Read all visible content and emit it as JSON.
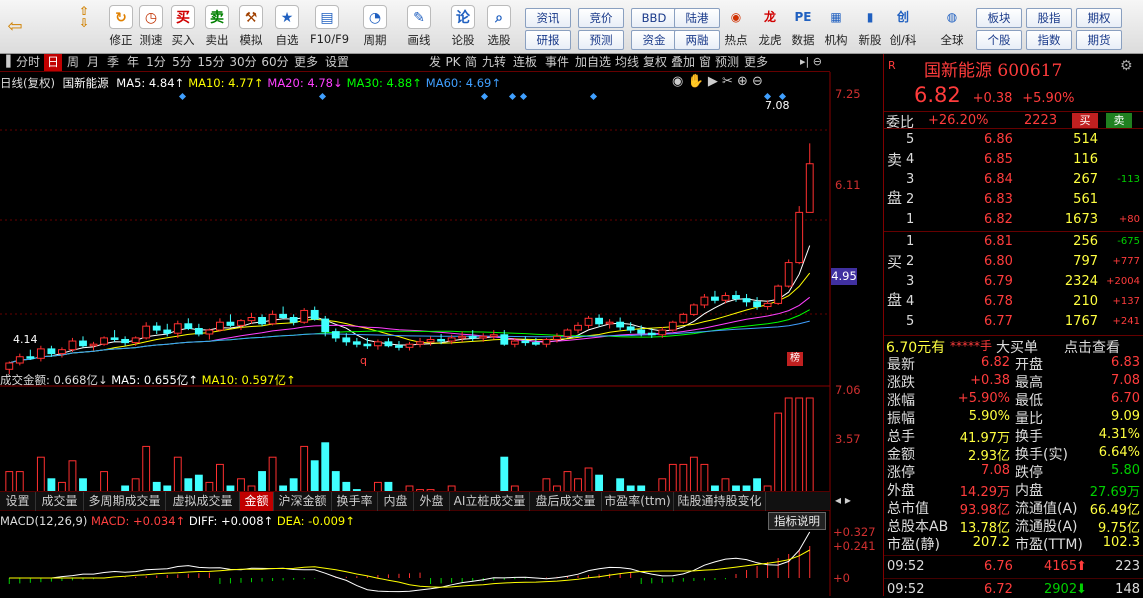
{
  "toolbar": {
    "buttons": [
      {
        "label": "修正",
        "icon": "refresh-icon",
        "glyph": "↻",
        "color": "#e08000"
      },
      {
        "label": "测速",
        "icon": "stopwatch-icon",
        "glyph": "◷",
        "color": "#c03000"
      },
      {
        "label": "买入",
        "icon": "buy-icon",
        "glyph": "买",
        "color": "#d00000"
      },
      {
        "label": "卖出",
        "icon": "sell-icon",
        "glyph": "卖",
        "color": "#008000"
      },
      {
        "label": "模拟",
        "icon": "hammer-icon",
        "glyph": "⚒",
        "color": "#a04000"
      },
      {
        "label": "自选",
        "icon": "star-icon",
        "glyph": "★",
        "color": "#2060c0"
      },
      {
        "label": "F10/F9",
        "icon": "window-icon",
        "glyph": "▤",
        "color": "#2060c0"
      },
      {
        "label": "周期",
        "icon": "clock-icon",
        "glyph": "◔",
        "color": "#2060c0"
      },
      {
        "label": "画线",
        "icon": "pencil-icon",
        "glyph": "✎",
        "color": "#2060c0"
      },
      {
        "label": "论股",
        "icon": "discuss-icon",
        "glyph": "论",
        "color": "#2060c0"
      },
      {
        "label": "选股",
        "icon": "search-icon",
        "glyph": "⌕",
        "color": "#2060c0"
      }
    ],
    "grid_buttons": [
      [
        "资讯",
        "研报"
      ],
      [
        "竞价",
        "预测"
      ],
      [
        "BBD",
        "资金"
      ],
      [
        "陆港",
        "两融"
      ]
    ],
    "icon_buttons": [
      {
        "label": "热点",
        "icon": "hot-icon",
        "glyph": "◉",
        "color": "#d03000"
      },
      {
        "label": "龙虎",
        "icon": "dragon-icon",
        "glyph": "龙",
        "color": "#d00000"
      },
      {
        "label": "数据",
        "icon": "pe-icon",
        "glyph": "PE",
        "color": "#2060c0"
      },
      {
        "label": "机构",
        "icon": "grid-icon",
        "glyph": "▦",
        "color": "#2060c0"
      },
      {
        "label": "新股",
        "icon": "chart-icon",
        "glyph": "▮",
        "color": "#2060c0"
      },
      {
        "label": "创/科",
        "icon": "chuang-icon",
        "glyph": "创",
        "color": "#2060c0"
      },
      {
        "label": "全球",
        "icon": "globe-icon",
        "glyph": "◍",
        "color": "#2060c0"
      }
    ],
    "grid_buttons2": [
      [
        "板块",
        "个股"
      ],
      [
        "股指",
        "指数"
      ],
      [
        "期权",
        "期货"
      ]
    ]
  },
  "period_tabs": [
    "分时",
    "日",
    "周",
    "月",
    "季",
    "年",
    "1分",
    "5分",
    "15分",
    "30分",
    "60分",
    "更多",
    "设置"
  ],
  "period_active": "日",
  "func_tabs": [
    "发",
    "PK",
    "简",
    "九转",
    "连板",
    "事件",
    "加自选",
    "均线",
    "复权",
    "叠加",
    "窗",
    "预测",
    "更多"
  ],
  "ma_line": {
    "prefix": "日线(复权)",
    "name": "国新能源",
    "items": [
      {
        "text": "MA5: 4.84↑",
        "color": "#ffffff"
      },
      {
        "text": "MA10: 4.77↑",
        "color": "#ffff00"
      },
      {
        "text": "MA20: 4.78↓",
        "color": "#ff40ff"
      },
      {
        "text": "MA30: 4.88↑",
        "color": "#00ff00"
      },
      {
        "text": "MA60: 4.69↑",
        "color": "#40a0ff"
      }
    ]
  },
  "price_axis": {
    "labels": [
      "7.25",
      "6.11",
      "4.95"
    ],
    "high_label": "7.08",
    "low_label": "4.14",
    "marker_q": "q",
    "marker_bang": "榜"
  },
  "volume": {
    "header": "成交金额: 0.668亿↓",
    "ma5": "MA5: 0.655亿↑",
    "ma10": "MA10: 0.597亿↑",
    "axis": [
      "7.06",
      "3.57"
    ]
  },
  "bottom_tabs": [
    "设置",
    "成交量",
    "多周期成交量",
    "虚拟成交量",
    "金额",
    "沪深金额",
    "换手率",
    "内盘",
    "外盘",
    "AI立桩成交量",
    "盘后成交量",
    "市盈率(ttm)",
    "陆股通持股变化"
  ],
  "bottom_active": "金额",
  "macd": {
    "title": "MACD(12,26,9)",
    "macd": "MACD: +0.034↑",
    "diff": "DIFF: +0.008↑",
    "dea": "DEA: -0.009↑",
    "axis": [
      "+0.327",
      "+0.241",
      "+0"
    ],
    "help_button": "指标说明"
  },
  "chart_data": {
    "type": "candlestick",
    "ylim": [
      4.14,
      7.25
    ],
    "candles": [
      [
        4.2,
        4.3,
        4.14,
        4.28
      ],
      [
        4.28,
        4.4,
        4.25,
        4.36
      ],
      [
        4.36,
        4.45,
        4.32,
        4.34
      ],
      [
        4.34,
        4.5,
        4.3,
        4.46
      ],
      [
        4.46,
        4.5,
        4.36,
        4.4
      ],
      [
        4.4,
        4.48,
        4.35,
        4.45
      ],
      [
        4.45,
        4.6,
        4.42,
        4.56
      ],
      [
        4.56,
        4.62,
        4.48,
        4.5
      ],
      [
        4.5,
        4.55,
        4.44,
        4.52
      ],
      [
        4.52,
        4.62,
        4.5,
        4.6
      ],
      [
        4.6,
        4.7,
        4.55,
        4.58
      ],
      [
        4.58,
        4.62,
        4.5,
        4.54
      ],
      [
        4.54,
        4.62,
        4.5,
        4.6
      ],
      [
        4.6,
        4.8,
        4.58,
        4.75
      ],
      [
        4.75,
        4.8,
        4.65,
        4.7
      ],
      [
        4.7,
        4.78,
        4.62,
        4.66
      ],
      [
        4.66,
        4.82,
        4.6,
        4.78
      ],
      [
        4.78,
        4.85,
        4.7,
        4.72
      ],
      [
        4.72,
        4.78,
        4.62,
        4.65
      ],
      [
        4.65,
        4.72,
        4.58,
        4.7
      ],
      [
        4.7,
        4.85,
        4.68,
        4.8
      ],
      [
        4.8,
        4.9,
        4.74,
        4.76
      ],
      [
        4.76,
        4.84,
        4.7,
        4.82
      ],
      [
        4.82,
        4.92,
        4.78,
        4.86
      ],
      [
        4.86,
        4.9,
        4.75,
        4.78
      ],
      [
        4.78,
        4.95,
        4.76,
        4.9
      ],
      [
        4.9,
        5.0,
        4.84,
        4.86
      ],
      [
        4.86,
        4.9,
        4.76,
        4.8
      ],
      [
        4.8,
        4.98,
        4.78,
        4.95
      ],
      [
        4.95,
        5.0,
        4.82,
        4.84
      ],
      [
        4.84,
        4.88,
        4.62,
        4.68
      ],
      [
        4.68,
        4.72,
        4.55,
        4.6
      ],
      [
        4.6,
        4.66,
        4.5,
        4.55
      ],
      [
        4.55,
        4.6,
        4.48,
        4.52
      ],
      [
        4.52,
        4.6,
        4.46,
        4.5
      ],
      [
        4.5,
        4.58,
        4.45,
        4.55
      ],
      [
        4.55,
        4.6,
        4.48,
        4.5
      ],
      [
        4.5,
        4.56,
        4.44,
        4.48
      ],
      [
        4.48,
        4.55,
        4.44,
        4.52
      ],
      [
        4.52,
        4.6,
        4.48,
        4.55
      ],
      [
        4.55,
        4.62,
        4.5,
        4.58
      ],
      [
        4.58,
        4.65,
        4.52,
        4.56
      ],
      [
        4.56,
        4.64,
        4.52,
        4.6
      ],
      [
        4.6,
        4.68,
        4.55,
        4.62
      ],
      [
        4.62,
        4.7,
        4.56,
        4.6
      ],
      [
        4.6,
        4.66,
        4.55,
        4.62
      ],
      [
        4.62,
        4.7,
        4.58,
        4.64
      ],
      [
        4.64,
        4.7,
        4.5,
        4.52
      ],
      [
        4.52,
        4.6,
        4.48,
        4.56
      ],
      [
        4.56,
        4.62,
        4.5,
        4.54
      ],
      [
        4.54,
        4.6,
        4.5,
        4.52
      ],
      [
        4.52,
        4.6,
        4.48,
        4.58
      ],
      [
        4.58,
        4.66,
        4.54,
        4.62
      ],
      [
        4.62,
        4.72,
        4.6,
        4.7
      ],
      [
        4.7,
        4.8,
        4.66,
        4.76
      ],
      [
        4.76,
        4.88,
        4.72,
        4.85
      ],
      [
        4.85,
        4.9,
        4.74,
        4.78
      ],
      [
        4.78,
        4.84,
        4.72,
        4.8
      ],
      [
        4.8,
        4.86,
        4.7,
        4.74
      ],
      [
        4.74,
        4.8,
        4.66,
        4.7
      ],
      [
        4.7,
        4.76,
        4.62,
        4.66
      ],
      [
        4.66,
        4.72,
        4.6,
        4.64
      ],
      [
        4.64,
        4.74,
        4.6,
        4.7
      ],
      [
        4.7,
        4.82,
        4.68,
        4.8
      ],
      [
        4.8,
        4.92,
        4.78,
        4.9
      ],
      [
        4.9,
        5.04,
        4.88,
        5.02
      ],
      [
        5.02,
        5.16,
        4.98,
        5.12
      ],
      [
        5.12,
        5.2,
        5.04,
        5.08
      ],
      [
        5.08,
        5.18,
        5.04,
        5.14
      ],
      [
        5.14,
        5.2,
        5.06,
        5.1
      ],
      [
        5.1,
        5.16,
        5.0,
        5.06
      ],
      [
        5.06,
        5.12,
        4.96,
        5.0
      ],
      [
        5.0,
        5.08,
        4.96,
        5.04
      ],
      [
        5.04,
        5.28,
        5.02,
        5.26
      ],
      [
        5.26,
        5.6,
        5.24,
        5.56
      ],
      [
        5.56,
        6.28,
        5.54,
        6.2
      ],
      [
        6.2,
        7.08,
        6.7,
        6.82
      ]
    ]
  },
  "quote": {
    "code_prefix": "R",
    "name": "国新能源",
    "code": "600617",
    "price": "6.82",
    "change": "+0.38",
    "pct": "+5.90%",
    "webi_label": "委比",
    "webi": "+26.20%",
    "weicha": "2223",
    "buy_btn": "买",
    "sell_btn": "卖",
    "sell_label": [
      "卖",
      "盘"
    ],
    "buy_label": [
      "买",
      "盘"
    ],
    "asks": [
      [
        "5",
        "6.86",
        "514",
        ""
      ],
      [
        "4",
        "6.85",
        "116",
        ""
      ],
      [
        "3",
        "6.84",
        "267",
        "-113"
      ],
      [
        "2",
        "6.83",
        "561",
        ""
      ],
      [
        "1",
        "6.82",
        "1673",
        "+80"
      ]
    ],
    "bids": [
      [
        "1",
        "6.81",
        "256",
        "-675"
      ],
      [
        "2",
        "6.80",
        "797",
        "+777"
      ],
      [
        "3",
        "6.79",
        "2324",
        "+2004"
      ],
      [
        "4",
        "6.78",
        "210",
        "+137"
      ],
      [
        "5",
        "6.77",
        "1767",
        "+241"
      ]
    ],
    "bigorder": {
      "left": "6.70元有",
      "mid": "*****手",
      "big": "大买单",
      "link": "点击查看"
    },
    "stats": [
      [
        "最新",
        "6.82",
        "开盘",
        "6.83"
      ],
      [
        "涨跌",
        "+0.38",
        "最高",
        "7.08"
      ],
      [
        "涨幅",
        "+5.90%",
        "最低",
        "6.70"
      ],
      [
        "振幅",
        "5.90%",
        "量比",
        "9.09"
      ],
      [
        "总手",
        "41.97万",
        "换手",
        "4.31%"
      ],
      [
        "金额",
        "2.93亿",
        "换手(实)",
        "6.64%"
      ],
      [
        "涨停",
        "7.08",
        "跌停",
        "5.80"
      ],
      [
        "外盘",
        "14.29万",
        "内盘",
        "27.69万"
      ],
      [
        "总市值",
        "93.98亿",
        "流通值(A)",
        "66.49亿"
      ],
      [
        "总股本AB",
        "13.78亿",
        "流通股(A)",
        "9.75亿"
      ],
      [
        "市盈(静)",
        "207.2",
        "市盈(TTM)",
        "102.3"
      ]
    ],
    "ticks": [
      [
        "09:52",
        "6.76",
        "4165",
        "223"
      ],
      [
        "09:52",
        "6.72",
        "2902",
        "148"
      ]
    ]
  }
}
